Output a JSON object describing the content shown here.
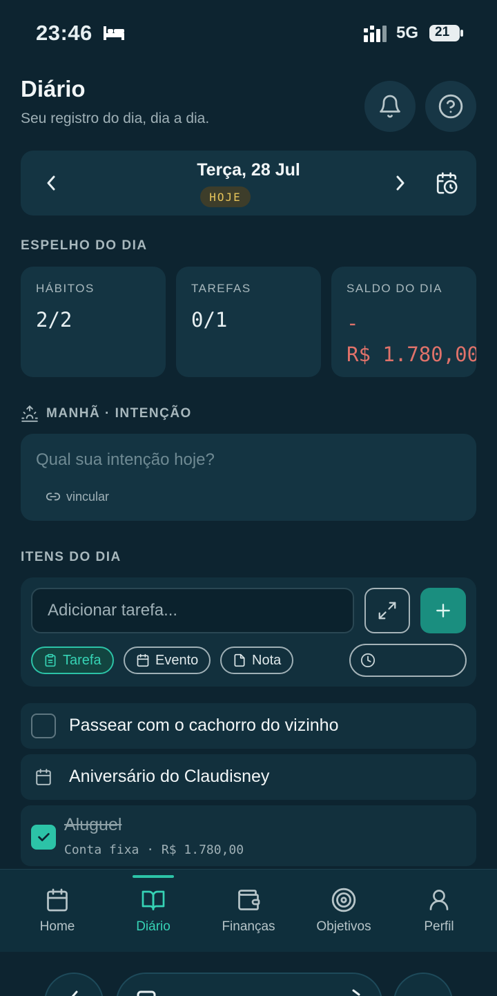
{
  "status_bar": {
    "time": "23:46",
    "network": "5G",
    "battery": "21"
  },
  "header": {
    "title": "Diário",
    "subtitle": "Seu registro do dia, dia a dia."
  },
  "date_nav": {
    "date": "Terça, 28 Jul",
    "badge": "HOJE"
  },
  "mirror": {
    "section_label": "ESPELHO DO DIA",
    "cards": [
      {
        "label": "HÁBITOS",
        "value": "2/2"
      },
      {
        "label": "TAREFAS",
        "value": "0/1"
      },
      {
        "label": "SALDO DO DIA",
        "sign": "-",
        "value": "R$ 1.780,00"
      }
    ]
  },
  "morning": {
    "section_label": "MANHÃ · INTENÇÃO",
    "placeholder": "Qual sua intenção hoje?",
    "link_label": "vincular"
  },
  "items": {
    "section_label": "ITENS DO DIA",
    "input_placeholder": "Adicionar tarefa...",
    "types": [
      "Tarefa",
      "Evento",
      "Nota"
    ],
    "list": [
      {
        "kind": "task",
        "title": "Passear com o cachorro do vizinho"
      },
      {
        "kind": "event",
        "title": "Aniversário do Claudisney"
      },
      {
        "kind": "task-done",
        "title": "Aluguel",
        "meta": "Conta fixa · R$ 1.780,00"
      }
    ]
  },
  "nav": {
    "items": [
      {
        "label": "Home"
      },
      {
        "label": "Diário"
      },
      {
        "label": "Finanças"
      },
      {
        "label": "Objetivos"
      },
      {
        "label": "Perfil"
      }
    ],
    "active": "Diário"
  },
  "colors": {
    "background": "#0d2430",
    "card": "#143442",
    "accent": "#2cc3a7",
    "negative": "#e0726a",
    "badge": "#e5c35a"
  }
}
